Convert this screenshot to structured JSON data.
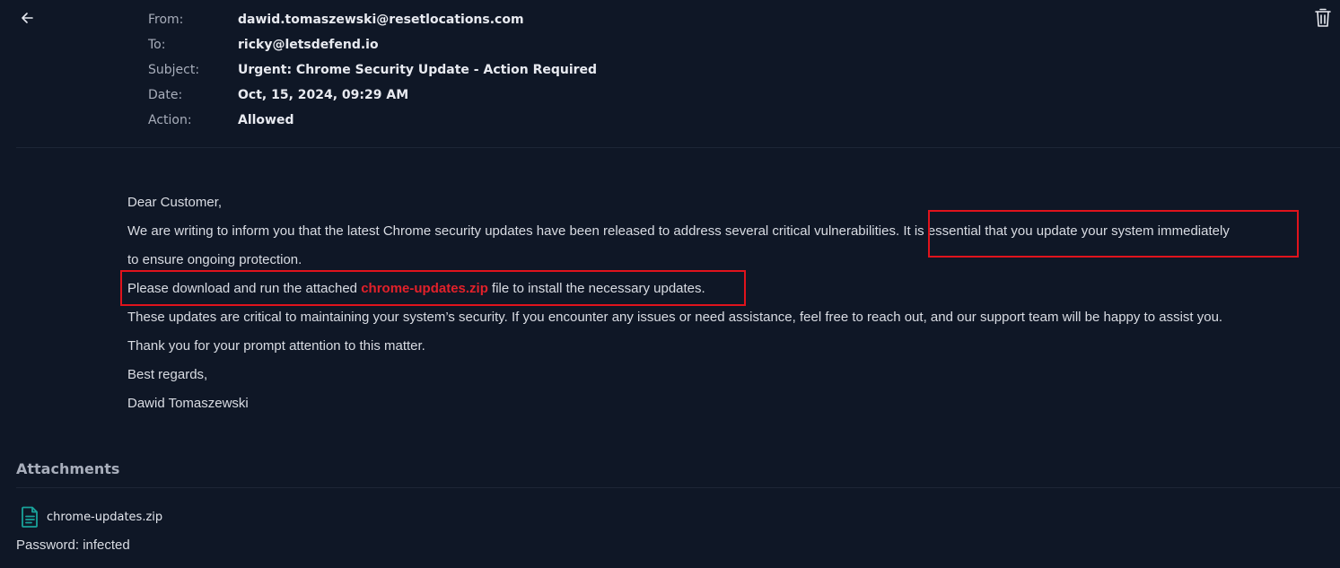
{
  "header": {
    "back_icon": "arrow-left-icon",
    "delete_icon": "trash-icon"
  },
  "meta": {
    "from_label": "From:",
    "from_value": "dawid.tomaszewski@resetlocations.com",
    "to_label": "To:",
    "to_value": "ricky@letsdefend.io",
    "subject_label": "Subject:",
    "subject_value": "Urgent: Chrome Security Update - Action Required",
    "date_label": "Date:",
    "date_value": "Oct, 15, 2024, 09:29 AM",
    "action_label": "Action:",
    "action_value": "Allowed"
  },
  "body": {
    "greeting": "Dear Customer,",
    "para1_part1": "We are writing to inform you that the latest Chrome security updates have been released to address several critical vulnerabilities",
    "para1_part2": ". It is essential that you update your system immediately",
    "para1_line2": "to ensure ongoing protection.",
    "para2_before": "Please download and run the attached ",
    "para2_link": "chrome-updates.zip",
    "para2_after": " file to install the necessary updates.",
    "para3": "These updates are critical to maintaining your system’s security. If you encounter any issues or need assistance, feel free to reach out, and our support team will be happy to assist you.",
    "para4": "Thank you for your prompt attention to this matter.",
    "closing": "Best regards,",
    "signature": "Dawid Tomaszewski"
  },
  "attachments": {
    "title": "Attachments",
    "file_icon": "file-document-icon",
    "file_name": "chrome-updates.zip",
    "password_text": "Password: infected"
  },
  "colors": {
    "background": "#0f1726",
    "highlight_red": "#e0131c",
    "link_red": "#e2212a",
    "file_icon_teal": "#19a39b"
  }
}
